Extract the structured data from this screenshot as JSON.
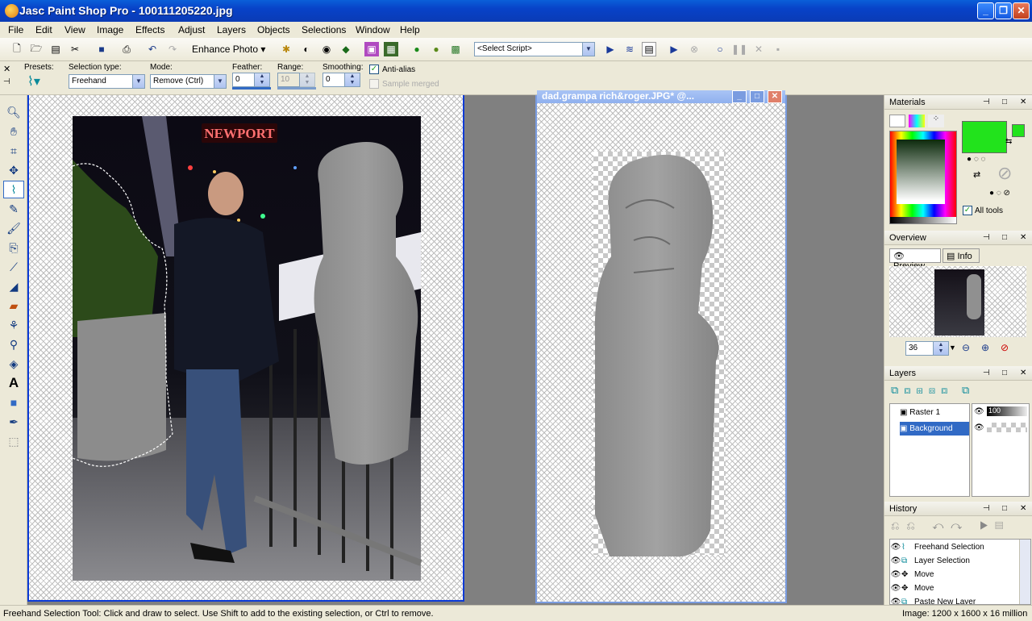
{
  "window": {
    "title": "Jasc Paint Shop Pro - 100111205220.jpg"
  },
  "menu": [
    "File",
    "Edit",
    "View",
    "Image",
    "Effects",
    "Adjust",
    "Layers",
    "Objects",
    "Selections",
    "Window",
    "Help"
  ],
  "toolbar": {
    "enhance_photo": "Enhance Photo",
    "script_select": "<Select Script>"
  },
  "tool_options": {
    "presets_label": "Presets:",
    "selection_type_label": "Selection type:",
    "selection_type_value": "Freehand",
    "mode_label": "Mode:",
    "mode_value": "Remove (Ctrl)",
    "feather_label": "Feather:",
    "feather_value": "0",
    "range_label": "Range:",
    "range_value": "10",
    "smoothing_label": "Smoothing:",
    "smoothing_value": "0",
    "anti_alias_label": "Anti-alias",
    "sample_merged_label": "Sample merged"
  },
  "canvas": {
    "sign_text": "NEWPORT",
    "doc2_title": "dad.grampa rich&roger.JPG* @..."
  },
  "materials": {
    "title": "Materials",
    "fg_color": "#22e31c",
    "all_tools_label": "All tools"
  },
  "overview": {
    "title": "Overview",
    "tab_preview": "Preview",
    "tab_info": "Info",
    "zoom_value": "36"
  },
  "layers": {
    "title": "Layers",
    "items": [
      {
        "name": "Raster 1",
        "opacity": "100"
      },
      {
        "name": "Background"
      }
    ]
  },
  "history": {
    "title": "History",
    "items": [
      "Freehand Selection",
      "Layer Selection",
      "Move",
      "Move",
      "Paste New Layer"
    ]
  },
  "status": {
    "hint": "Freehand Selection Tool: Click and draw to select. Use Shift to add to the existing selection, or Ctrl to remove.",
    "image_info": "Image:  1200 x 1600 x 16 million"
  }
}
